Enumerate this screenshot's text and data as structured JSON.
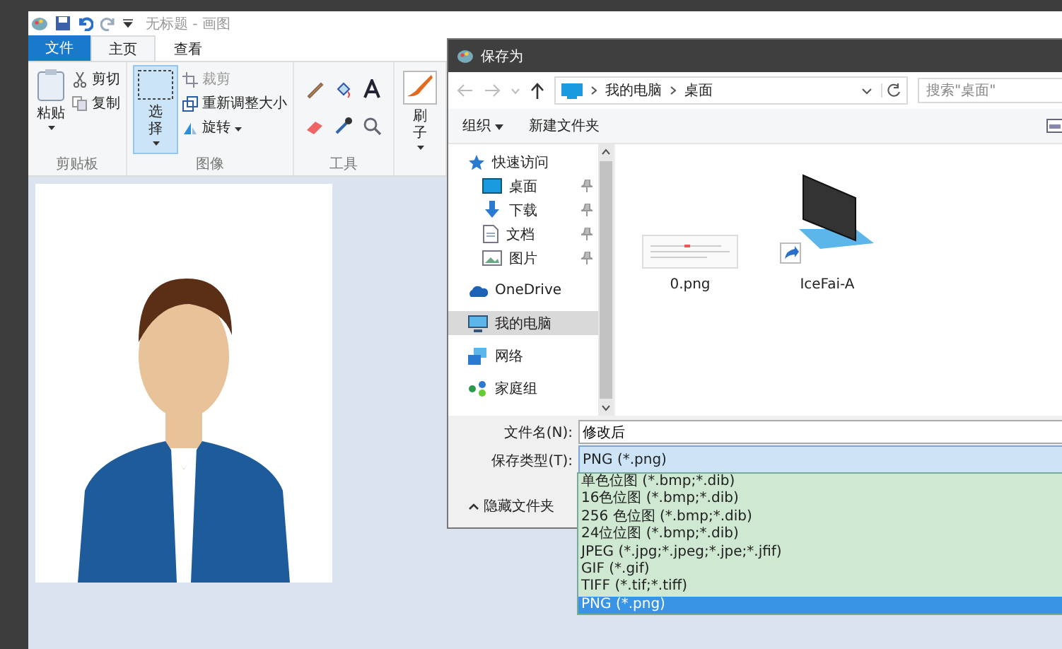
{
  "paint": {
    "title": "无标题 - 画图",
    "tabs": [
      {
        "label": "文件",
        "kind": "file",
        "selected": false
      },
      {
        "label": "主页",
        "kind": "tab",
        "selected": true
      },
      {
        "label": "查看",
        "kind": "tab",
        "selected": false
      }
    ],
    "clipboard": {
      "paste": "粘贴",
      "commands": [
        {
          "label": "剪切",
          "kind": "cut"
        },
        {
          "label": "复制",
          "kind": "copy"
        }
      ],
      "group_label": "剪贴板"
    },
    "image": {
      "select": "选择",
      "commands": [
        {
          "label": "裁剪",
          "kind": "crop",
          "disabled": true
        },
        {
          "label": "重新调整大小",
          "kind": "resize",
          "disabled": false
        },
        {
          "label": "旋转",
          "kind": "rotate",
          "disabled": false
        }
      ],
      "group_label": "图像"
    },
    "tools": {
      "group_label": "工具"
    },
    "brush": "刷子"
  },
  "dialog": {
    "title": "保存为",
    "breadcrumb": [
      "我的电脑",
      "桌面"
    ],
    "search": {
      "placeholder": "搜索\"桌面\""
    },
    "toolbar": [
      "组织",
      "新建文件夹"
    ],
    "sidebar": [
      {
        "label": "快速访问",
        "kind": "star",
        "selected": false,
        "children": [
          {
            "label": "桌面",
            "kind": "desktop",
            "pinned": true,
            "selected": false
          },
          {
            "label": "下载",
            "kind": "download",
            "pinned": true,
            "selected": false
          },
          {
            "label": "文档",
            "kind": "document",
            "pinned": true,
            "selected": false
          },
          {
            "label": "图片",
            "kind": "picture",
            "pinned": true,
            "selected": false
          }
        ]
      },
      {
        "label": "OneDrive",
        "kind": "cloud",
        "selected": false
      },
      {
        "label": "我的电脑",
        "kind": "computer",
        "selected": true
      },
      {
        "label": "网络",
        "kind": "network",
        "selected": false
      },
      {
        "label": "家庭组",
        "kind": "homegroup",
        "selected": false
      }
    ],
    "files": [
      {
        "name": "0.png",
        "kind": "image"
      },
      {
        "name": "IceFai-A",
        "kind": "shortcut"
      }
    ],
    "filename": {
      "label": "文件名(N):",
      "value": "修改后"
    },
    "filetype": {
      "label": "保存类型(T):",
      "value": "PNG (*.png)"
    },
    "filetype_options": [
      {
        "label": "单色位图 (*.bmp;*.dib)",
        "selected": false
      },
      {
        "label": "16色位图 (*.bmp;*.dib)",
        "selected": false
      },
      {
        "label": "256 色位图 (*.bmp;*.dib)",
        "selected": false
      },
      {
        "label": "24位位图 (*.bmp;*.dib)",
        "selected": false
      },
      {
        "label": "JPEG (*.jpg;*.jpeg;*.jpe;*.jfif)",
        "selected": false
      },
      {
        "label": "GIF (*.gif)",
        "selected": false
      },
      {
        "label": "TIFF (*.tif;*.tiff)",
        "selected": false
      },
      {
        "label": "PNG (*.png)",
        "selected": true
      }
    ],
    "hide_folders": "隐藏文件夹"
  }
}
